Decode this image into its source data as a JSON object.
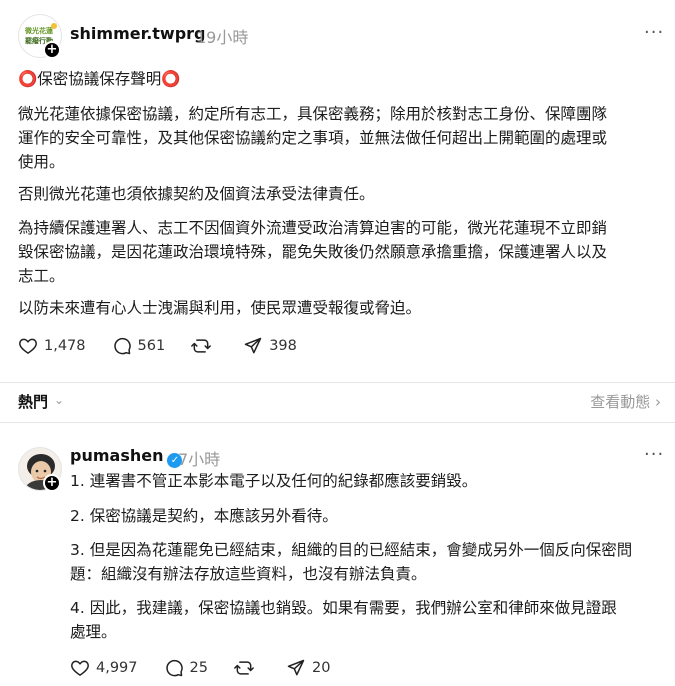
{
  "post1": {
    "username": "shimmer.twprg",
    "time": "19小時",
    "avatar_logo_line1": "微光花蓮",
    "avatar_logo_line2": "罷癈行動",
    "title": "⭕保密協議保存聲明⭕",
    "para1_l1": "微光花蓮依據保密協議，約定所有志工，具保密義務；除用於核對志工身份、保障團隊",
    "para1_l2": "運作的安全可靠性，及其他保密協議約定之事項，並無法做任何超出上開範圍的處理或",
    "para1_l3": "使用。",
    "para2": "否則微光花蓮也須依據契約及個資法承受法律責任。",
    "para3_l1": "為持續保護連署人、志工不因個資外流遭受政治清算迫害的可能，微光花蓮現不立即銷",
    "para3_l2": "毀保密協議，是因花蓮政治環境特殊，罷免失敗後仍然願意承擔重擔，保護連署人以及",
    "para3_l3": "志工。",
    "para4": "以防未來遭有心人士洩漏與利用，使民眾遭受報復或脅迫。",
    "likes": "1,478",
    "comments": "561",
    "shares": "398"
  },
  "hot_bar": {
    "label": "熱門",
    "activity": "查看動態 ›"
  },
  "post2": {
    "username": "pumashen",
    "time": "7小時",
    "item1": "1. 連署書不管正本影本電子以及任何的紀錄都應該要銷毀。",
    "item2": "2. 保密協議是契約，本應該另外看待。",
    "item3_l1": "3. 但是因為花蓮罷免已經結束，組織的目的已經結束，會變成另外一個反向保密問",
    "item3_l2": "題：組織沒有辦法存放這些資料，也沒有辦法負責。",
    "item4_l1": "4. 因此，我建議，保密協議也銷毀。如果有需要，我們辦公室和律師來做見證跟",
    "item4_l2": "處理。",
    "likes": "4,997",
    "comments": "25",
    "shares": "20"
  }
}
